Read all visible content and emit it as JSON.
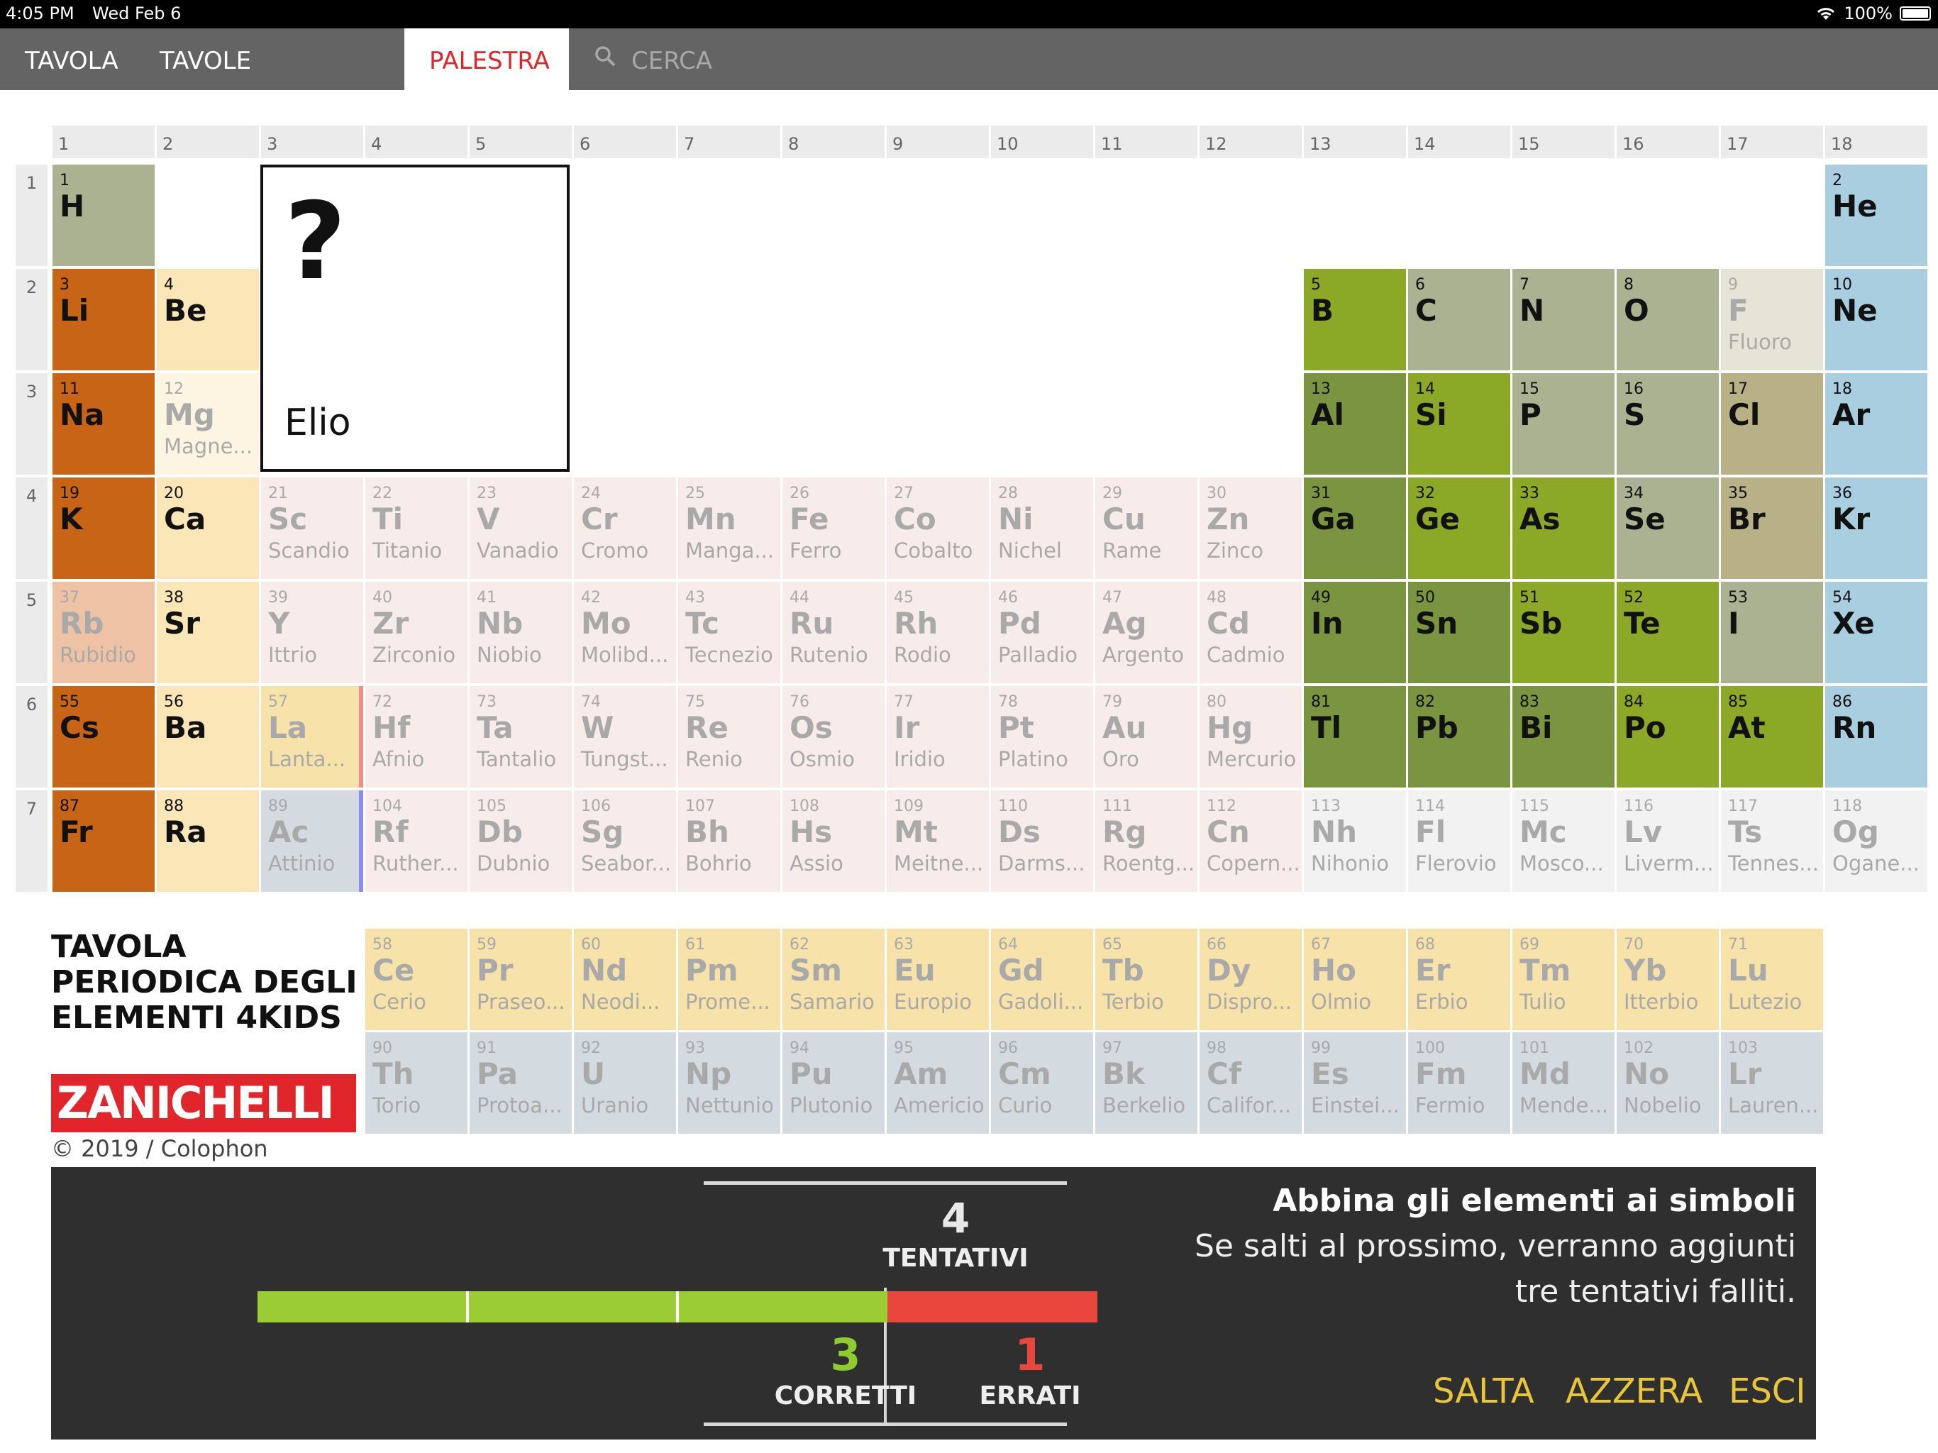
{
  "status": {
    "time": "4:05 PM",
    "date": "Wed Feb 6",
    "battery": "100%"
  },
  "nav": {
    "tabs": [
      {
        "label": "TAVOLA"
      },
      {
        "label": "TAVOLE TEMATICHE"
      },
      {
        "label": "PALESTRA"
      },
      {
        "label": "CERCA"
      }
    ]
  },
  "group_headers": [
    "1",
    "2",
    "3",
    "4",
    "5",
    "6",
    "7",
    "8",
    "9",
    "10",
    "11",
    "12",
    "13",
    "14",
    "15",
    "16",
    "17",
    "18"
  ],
  "period_headers": [
    "1",
    "2",
    "3",
    "4",
    "5",
    "6",
    "7"
  ],
  "question": {
    "mark": "?",
    "name": "Elio"
  },
  "elements": [
    {
      "n": "1",
      "s": "H",
      "nm": "",
      "g": 1,
      "p": 1,
      "bg": "#aab291",
      "st": "active"
    },
    {
      "n": "2",
      "s": "He",
      "nm": "",
      "g": 18,
      "p": 1,
      "bg": "#a9cee0",
      "st": "active"
    },
    {
      "n": "3",
      "s": "Li",
      "nm": "",
      "g": 1,
      "p": 2,
      "bg": "#c76415",
      "st": "active"
    },
    {
      "n": "4",
      "s": "Be",
      "nm": "",
      "g": 2,
      "p": 2,
      "bg": "#fae6b6",
      "st": "active"
    },
    {
      "n": "5",
      "s": "B",
      "nm": "",
      "g": 13,
      "p": 2,
      "bg": "#8ba826",
      "st": "active"
    },
    {
      "n": "6",
      "s": "C",
      "nm": "",
      "g": 14,
      "p": 2,
      "bg": "#aab291",
      "st": "active"
    },
    {
      "n": "7",
      "s": "N",
      "nm": "",
      "g": 15,
      "p": 2,
      "bg": "#aab291",
      "st": "active"
    },
    {
      "n": "8",
      "s": "O",
      "nm": "",
      "g": 16,
      "p": 2,
      "bg": "#aab291",
      "st": "active"
    },
    {
      "n": "9",
      "s": "F",
      "nm": "Fluoro",
      "g": 17,
      "p": 2,
      "bg": "#e6e4d6",
      "st": "inactive"
    },
    {
      "n": "10",
      "s": "Ne",
      "nm": "",
      "g": 18,
      "p": 2,
      "bg": "#a9cee0",
      "st": "active"
    },
    {
      "n": "11",
      "s": "Na",
      "nm": "",
      "g": 1,
      "p": 3,
      "bg": "#c76415",
      "st": "active"
    },
    {
      "n": "12",
      "s": "Mg",
      "nm": "Magne...",
      "g": 2,
      "p": 3,
      "bg": "#fdf5e1",
      "st": "inactive"
    },
    {
      "n": "13",
      "s": "Al",
      "nm": "",
      "g": 13,
      "p": 3,
      "bg": "#7a9440",
      "st": "active"
    },
    {
      "n": "14",
      "s": "Si",
      "nm": "",
      "g": 14,
      "p": 3,
      "bg": "#8ba826",
      "st": "active"
    },
    {
      "n": "15",
      "s": "P",
      "nm": "",
      "g": 15,
      "p": 3,
      "bg": "#aab291",
      "st": "active"
    },
    {
      "n": "16",
      "s": "S",
      "nm": "",
      "g": 16,
      "p": 3,
      "bg": "#aab291",
      "st": "active"
    },
    {
      "n": "17",
      "s": "Cl",
      "nm": "",
      "g": 17,
      "p": 3,
      "bg": "#b8b188",
      "st": "active"
    },
    {
      "n": "18",
      "s": "Ar",
      "nm": "",
      "g": 18,
      "p": 3,
      "bg": "#a9cee0",
      "st": "active"
    },
    {
      "n": "19",
      "s": "K",
      "nm": "",
      "g": 1,
      "p": 4,
      "bg": "#c76415",
      "st": "active"
    },
    {
      "n": "20",
      "s": "Ca",
      "nm": "",
      "g": 2,
      "p": 4,
      "bg": "#fae6b6",
      "st": "active"
    },
    {
      "n": "21",
      "s": "Sc",
      "nm": "Scandio",
      "g": 3,
      "p": 4,
      "bg": "#f8eceb",
      "st": "inactive"
    },
    {
      "n": "22",
      "s": "Ti",
      "nm": "Titanio",
      "g": 4,
      "p": 4,
      "bg": "#f8eceb",
      "st": "inactive"
    },
    {
      "n": "23",
      "s": "V",
      "nm": "Vanadio",
      "g": 5,
      "p": 4,
      "bg": "#f8eceb",
      "st": "inactive"
    },
    {
      "n": "24",
      "s": "Cr",
      "nm": "Cromo",
      "g": 6,
      "p": 4,
      "bg": "#f8eceb",
      "st": "inactive"
    },
    {
      "n": "25",
      "s": "Mn",
      "nm": "Manga...",
      "g": 7,
      "p": 4,
      "bg": "#f8eceb",
      "st": "inactive"
    },
    {
      "n": "26",
      "s": "Fe",
      "nm": "Ferro",
      "g": 8,
      "p": 4,
      "bg": "#f8eceb",
      "st": "inactive"
    },
    {
      "n": "27",
      "s": "Co",
      "nm": "Cobalto",
      "g": 9,
      "p": 4,
      "bg": "#f8eceb",
      "st": "inactive"
    },
    {
      "n": "28",
      "s": "Ni",
      "nm": "Nichel",
      "g": 10,
      "p": 4,
      "bg": "#f8eceb",
      "st": "inactive"
    },
    {
      "n": "29",
      "s": "Cu",
      "nm": "Rame",
      "g": 11,
      "p": 4,
      "bg": "#f8eceb",
      "st": "inactive"
    },
    {
      "n": "30",
      "s": "Zn",
      "nm": "Zinco",
      "g": 12,
      "p": 4,
      "bg": "#f8eceb",
      "st": "inactive"
    },
    {
      "n": "31",
      "s": "Ga",
      "nm": "",
      "g": 13,
      "p": 4,
      "bg": "#7a9440",
      "st": "active"
    },
    {
      "n": "32",
      "s": "Ge",
      "nm": "",
      "g": 14,
      "p": 4,
      "bg": "#8ba826",
      "st": "active"
    },
    {
      "n": "33",
      "s": "As",
      "nm": "",
      "g": 15,
      "p": 4,
      "bg": "#8ba826",
      "st": "active"
    },
    {
      "n": "34",
      "s": "Se",
      "nm": "",
      "g": 16,
      "p": 4,
      "bg": "#aab291",
      "st": "active"
    },
    {
      "n": "35",
      "s": "Br",
      "nm": "",
      "g": 17,
      "p": 4,
      "bg": "#b8b188",
      "st": "active"
    },
    {
      "n": "36",
      "s": "Kr",
      "nm": "",
      "g": 18,
      "p": 4,
      "bg": "#a9cee0",
      "st": "active"
    },
    {
      "n": "37",
      "s": "Rb",
      "nm": "Rubidio",
      "g": 1,
      "p": 5,
      "bg": "#eec2a4",
      "st": "inactive"
    },
    {
      "n": "38",
      "s": "Sr",
      "nm": "",
      "g": 2,
      "p": 5,
      "bg": "#fae6b6",
      "st": "active"
    },
    {
      "n": "39",
      "s": "Y",
      "nm": "Ittrio",
      "g": 3,
      "p": 5,
      "bg": "#f8eceb",
      "st": "inactive"
    },
    {
      "n": "40",
      "s": "Zr",
      "nm": "Zirconio",
      "g": 4,
      "p": 5,
      "bg": "#f8eceb",
      "st": "inactive"
    },
    {
      "n": "41",
      "s": "Nb",
      "nm": "Niobio",
      "g": 5,
      "p": 5,
      "bg": "#f8eceb",
      "st": "inactive"
    },
    {
      "n": "42",
      "s": "Mo",
      "nm": "Molibd...",
      "g": 6,
      "p": 5,
      "bg": "#f8eceb",
      "st": "inactive"
    },
    {
      "n": "43",
      "s": "Tc",
      "nm": "Tecnezio",
      "g": 7,
      "p": 5,
      "bg": "#f8eceb",
      "st": "inactive"
    },
    {
      "n": "44",
      "s": "Ru",
      "nm": "Rutenio",
      "g": 8,
      "p": 5,
      "bg": "#f8eceb",
      "st": "inactive"
    },
    {
      "n": "45",
      "s": "Rh",
      "nm": "Rodio",
      "g": 9,
      "p": 5,
      "bg": "#f8eceb",
      "st": "inactive"
    },
    {
      "n": "46",
      "s": "Pd",
      "nm": "Palladio",
      "g": 10,
      "p": 5,
      "bg": "#f8eceb",
      "st": "inactive"
    },
    {
      "n": "47",
      "s": "Ag",
      "nm": "Argento",
      "g": 11,
      "p": 5,
      "bg": "#f8eceb",
      "st": "inactive"
    },
    {
      "n": "48",
      "s": "Cd",
      "nm": "Cadmio",
      "g": 12,
      "p": 5,
      "bg": "#f8eceb",
      "st": "inactive"
    },
    {
      "n": "49",
      "s": "In",
      "nm": "",
      "g": 13,
      "p": 5,
      "bg": "#7a9440",
      "st": "active"
    },
    {
      "n": "50",
      "s": "Sn",
      "nm": "",
      "g": 14,
      "p": 5,
      "bg": "#7a9440",
      "st": "active"
    },
    {
      "n": "51",
      "s": "Sb",
      "nm": "",
      "g": 15,
      "p": 5,
      "bg": "#8ba826",
      "st": "active"
    },
    {
      "n": "52",
      "s": "Te",
      "nm": "",
      "g": 16,
      "p": 5,
      "bg": "#8ba826",
      "st": "active"
    },
    {
      "n": "53",
      "s": "I",
      "nm": "",
      "g": 17,
      "p": 5,
      "bg": "#aab291",
      "st": "active"
    },
    {
      "n": "54",
      "s": "Xe",
      "nm": "",
      "g": 18,
      "p": 5,
      "bg": "#a9cee0",
      "st": "active"
    },
    {
      "n": "55",
      "s": "Cs",
      "nm": "",
      "g": 1,
      "p": 6,
      "bg": "#c76415",
      "st": "active"
    },
    {
      "n": "56",
      "s": "Ba",
      "nm": "",
      "g": 2,
      "p": 6,
      "bg": "#fae6b6",
      "st": "active"
    },
    {
      "n": "57",
      "s": "La",
      "nm": "Lanta...",
      "g": 3,
      "p": 6,
      "bg": "#f7e2aa",
      "st": "inactive"
    },
    {
      "n": "72",
      "s": "Hf",
      "nm": "Afnio",
      "g": 4,
      "p": 6,
      "bg": "#f8eceb",
      "st": "inactive"
    },
    {
      "n": "73",
      "s": "Ta",
      "nm": "Tantalio",
      "g": 5,
      "p": 6,
      "bg": "#f8eceb",
      "st": "inactive"
    },
    {
      "n": "74",
      "s": "W",
      "nm": "Tungst...",
      "g": 6,
      "p": 6,
      "bg": "#f8eceb",
      "st": "inactive"
    },
    {
      "n": "75",
      "s": "Re",
      "nm": "Renio",
      "g": 7,
      "p": 6,
      "bg": "#f8eceb",
      "st": "inactive"
    },
    {
      "n": "76",
      "s": "Os",
      "nm": "Osmio",
      "g": 8,
      "p": 6,
      "bg": "#f8eceb",
      "st": "inactive"
    },
    {
      "n": "77",
      "s": "Ir",
      "nm": "Iridio",
      "g": 9,
      "p": 6,
      "bg": "#f8eceb",
      "st": "inactive"
    },
    {
      "n": "78",
      "s": "Pt",
      "nm": "Platino",
      "g": 10,
      "p": 6,
      "bg": "#f8eceb",
      "st": "inactive"
    },
    {
      "n": "79",
      "s": "Au",
      "nm": "Oro",
      "g": 11,
      "p": 6,
      "bg": "#f8eceb",
      "st": "inactive"
    },
    {
      "n": "80",
      "s": "Hg",
      "nm": "Mercurio",
      "g": 12,
      "p": 6,
      "bg": "#f8eceb",
      "st": "inactive"
    },
    {
      "n": "81",
      "s": "Tl",
      "nm": "",
      "g": 13,
      "p": 6,
      "bg": "#7a9440",
      "st": "active"
    },
    {
      "n": "82",
      "s": "Pb",
      "nm": "",
      "g": 14,
      "p": 6,
      "bg": "#7a9440",
      "st": "active"
    },
    {
      "n": "83",
      "s": "Bi",
      "nm": "",
      "g": 15,
      "p": 6,
      "bg": "#7a9440",
      "st": "active"
    },
    {
      "n": "84",
      "s": "Po",
      "nm": "",
      "g": 16,
      "p": 6,
      "bg": "#8ba826",
      "st": "active"
    },
    {
      "n": "85",
      "s": "At",
      "nm": "",
      "g": 17,
      "p": 6,
      "bg": "#8ba826",
      "st": "active"
    },
    {
      "n": "86",
      "s": "Rn",
      "nm": "",
      "g": 18,
      "p": 6,
      "bg": "#a9cee0",
      "st": "active"
    },
    {
      "n": "87",
      "s": "Fr",
      "nm": "",
      "g": 1,
      "p": 7,
      "bg": "#c76415",
      "st": "active"
    },
    {
      "n": "88",
      "s": "Ra",
      "nm": "",
      "g": 2,
      "p": 7,
      "bg": "#fae6b6",
      "st": "active"
    },
    {
      "n": "89",
      "s": "Ac",
      "nm": "Attinio",
      "g": 3,
      "p": 7,
      "bg": "#d3dbe1",
      "st": "inactive"
    },
    {
      "n": "104",
      "s": "Rf",
      "nm": "Ruther...",
      "g": 4,
      "p": 7,
      "bg": "#f8eceb",
      "st": "inactive"
    },
    {
      "n": "105",
      "s": "Db",
      "nm": "Dubnio",
      "g": 5,
      "p": 7,
      "bg": "#f8eceb",
      "st": "inactive"
    },
    {
      "n": "106",
      "s": "Sg",
      "nm": "Seabor...",
      "g": 6,
      "p": 7,
      "bg": "#f8eceb",
      "st": "inactive"
    },
    {
      "n": "107",
      "s": "Bh",
      "nm": "Bohrio",
      "g": 7,
      "p": 7,
      "bg": "#f8eceb",
      "st": "inactive"
    },
    {
      "n": "108",
      "s": "Hs",
      "nm": "Assio",
      "g": 8,
      "p": 7,
      "bg": "#f8eceb",
      "st": "inactive"
    },
    {
      "n": "109",
      "s": "Mt",
      "nm": "Meitne...",
      "g": 9,
      "p": 7,
      "bg": "#f8eceb",
      "st": "inactive"
    },
    {
      "n": "110",
      "s": "Ds",
      "nm": "Darms...",
      "g": 10,
      "p": 7,
      "bg": "#f8eceb",
      "st": "inactive"
    },
    {
      "n": "111",
      "s": "Rg",
      "nm": "Roentg...",
      "g": 11,
      "p": 7,
      "bg": "#f8eceb",
      "st": "inactive"
    },
    {
      "n": "112",
      "s": "Cn",
      "nm": "Copern...",
      "g": 12,
      "p": 7,
      "bg": "#f8eceb",
      "st": "inactive"
    },
    {
      "n": "113",
      "s": "Nh",
      "nm": "Nihonio",
      "g": 13,
      "p": 7,
      "bg": "#f2f2f2",
      "st": "inactive"
    },
    {
      "n": "114",
      "s": "Fl",
      "nm": "Flerovio",
      "g": 14,
      "p": 7,
      "bg": "#f2f2f2",
      "st": "inactive"
    },
    {
      "n": "115",
      "s": "Mc",
      "nm": "Mosco...",
      "g": 15,
      "p": 7,
      "bg": "#f2f2f2",
      "st": "inactive"
    },
    {
      "n": "116",
      "s": "Lv",
      "nm": "Liverm...",
      "g": 16,
      "p": 7,
      "bg": "#f2f2f2",
      "st": "inactive"
    },
    {
      "n": "117",
      "s": "Ts",
      "nm": "Tennes...",
      "g": 17,
      "p": 7,
      "bg": "#f2f2f2",
      "st": "inactive"
    },
    {
      "n": "118",
      "s": "Og",
      "nm": "Ogane...",
      "g": 18,
      "p": 7,
      "bg": "#f2f2f2",
      "st": "inactive"
    }
  ],
  "lanthanides": [
    {
      "n": "58",
      "s": "Ce",
      "nm": "Cerio"
    },
    {
      "n": "59",
      "s": "Pr",
      "nm": "Praseo..."
    },
    {
      "n": "60",
      "s": "Nd",
      "nm": "Neodi..."
    },
    {
      "n": "61",
      "s": "Pm",
      "nm": "Prome..."
    },
    {
      "n": "62",
      "s": "Sm",
      "nm": "Samario"
    },
    {
      "n": "63",
      "s": "Eu",
      "nm": "Europio"
    },
    {
      "n": "64",
      "s": "Gd",
      "nm": "Gadoli..."
    },
    {
      "n": "65",
      "s": "Tb",
      "nm": "Terbio"
    },
    {
      "n": "66",
      "s": "Dy",
      "nm": "Dispro..."
    },
    {
      "n": "67",
      "s": "Ho",
      "nm": "Olmio"
    },
    {
      "n": "68",
      "s": "Er",
      "nm": "Erbio"
    },
    {
      "n": "69",
      "s": "Tm",
      "nm": "Tulio"
    },
    {
      "n": "70",
      "s": "Yb",
      "nm": "Itterbio"
    },
    {
      "n": "71",
      "s": "Lu",
      "nm": "Lutezio"
    }
  ],
  "actinides": [
    {
      "n": "90",
      "s": "Th",
      "nm": "Torio"
    },
    {
      "n": "91",
      "s": "Pa",
      "nm": "Protoa..."
    },
    {
      "n": "92",
      "s": "U",
      "nm": "Uranio"
    },
    {
      "n": "93",
      "s": "Np",
      "nm": "Nettunio"
    },
    {
      "n": "94",
      "s": "Pu",
      "nm": "Plutonio"
    },
    {
      "n": "95",
      "s": "Am",
      "nm": "Americio"
    },
    {
      "n": "96",
      "s": "Cm",
      "nm": "Curio"
    },
    {
      "n": "97",
      "s": "Bk",
      "nm": "Berkelio"
    },
    {
      "n": "98",
      "s": "Cf",
      "nm": "Califor..."
    },
    {
      "n": "99",
      "s": "Es",
      "nm": "Einstei..."
    },
    {
      "n": "100",
      "s": "Fm",
      "nm": "Fermio"
    },
    {
      "n": "101",
      "s": "Md",
      "nm": "Mende..."
    },
    {
      "n": "102",
      "s": "No",
      "nm": "Nobelio"
    },
    {
      "n": "103",
      "s": "Lr",
      "nm": "Lauren..."
    }
  ],
  "colors": {
    "lanthanide_bg": "#f7e2aa",
    "actinide_bg": "#d3dbe1",
    "brand_red": "#e0262b",
    "correct": "#9ccc34",
    "wrong": "#e9473d",
    "action": "#e8c63b",
    "la_marker": "#f08c8c",
    "ac_marker": "#8b8bf0"
  },
  "brand": {
    "title_lines": [
      "TAVOLA",
      "PERIODICA DEGLI",
      "ELEMENTI 4KIDS"
    ],
    "logo": "ZANICHELLI",
    "colophon": "© 2019 / Colophon"
  },
  "score": {
    "attempts": "4",
    "attempts_label": "TENTATIVI",
    "correct": "3",
    "correct_label": "CORRETTI",
    "wrong": "1",
    "wrong_label": "ERRATI",
    "correct_count": 3,
    "wrong_count": 1
  },
  "instructions": {
    "title": "Abbina gli elementi ai simboli",
    "body": "Se salti al prossimo, verranno aggiunti tre tentativi falliti."
  },
  "actions": {
    "skip": "SALTA",
    "reset": "AZZERA",
    "exit": "ESCI"
  }
}
